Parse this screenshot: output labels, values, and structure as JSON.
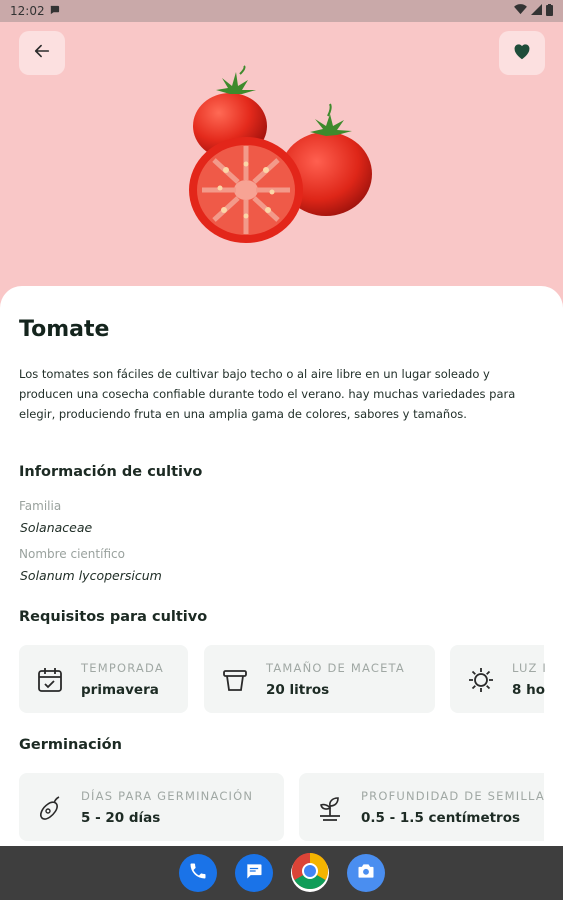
{
  "status_bar": {
    "time": "12:02"
  },
  "colors": {
    "hero_bg": "#f9c7c7",
    "accent_green": "#1f4d3a",
    "card_bg": "#f3f5f4"
  },
  "header": {
    "back_icon": "arrow-left-icon",
    "favorite_icon": "heart-icon"
  },
  "plant": {
    "name": "Tomate",
    "description": "Los tomates son fáciles de cultivar bajo techo o al aire libre en un lugar soleado y producen una cosecha confiable durante todo el verano. hay muchas variedades para elegir, produciendo fruta en una amplia gama de colores, sabores y tamaños."
  },
  "cultivation_info": {
    "heading": "Información de cultivo",
    "family_label": "Familia",
    "family_value": "Solanaceae",
    "scientific_label": "Nombre científico",
    "scientific_value": "Solanum lycopersicum"
  },
  "requirements": {
    "heading": "Requisitos para cultivo",
    "cards": [
      {
        "icon": "calendar-icon",
        "title": "TEMPORADA",
        "value": "primavera"
      },
      {
        "icon": "flower-pot-icon",
        "title": "TAMAÑO DE MACETA",
        "value": "20 litros"
      },
      {
        "icon": "sun-icon",
        "title": "LUZ I",
        "value": "8 ho"
      }
    ]
  },
  "germination": {
    "heading": "Germinación",
    "cards": [
      {
        "icon": "seed-icon",
        "title": "DÍAS PARA GERMINACIÓN",
        "value": "5 - 20 días"
      },
      {
        "icon": "sprout-icon",
        "title": "PROFUNDIDAD DE SEMILLA",
        "value": "0.5 - 1.5 centímetros"
      }
    ]
  },
  "dock": {
    "apps": [
      {
        "icon": "phone-icon",
        "color": "#1a73e8"
      },
      {
        "icon": "messages-icon",
        "color": "#1a73e8"
      },
      {
        "icon": "chrome-icon",
        "color": "#ffffff"
      },
      {
        "icon": "camera-icon",
        "color": "#4a8ef0"
      }
    ]
  }
}
